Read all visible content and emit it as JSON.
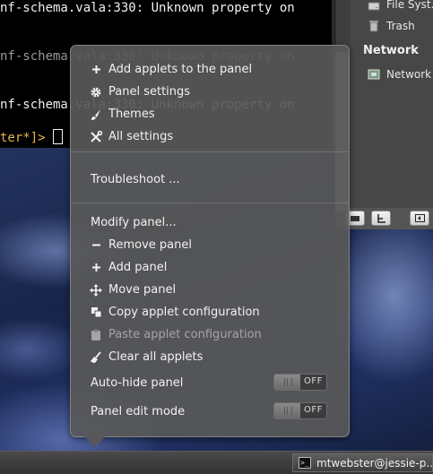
{
  "terminal": {
    "lines": [
      "nf-schema.vala:330: Unknown property on",
      "nf-schema.vala:330: Unknown property on",
      "nf-schema.vala:330: Unknown property on"
    ],
    "prompt": "ter*]>"
  },
  "file_manager": {
    "items": {
      "file_system": "File Syst...",
      "trash": "Trash",
      "network_heading": "Network",
      "network": "Network"
    },
    "toolbar_icons": [
      "drive-icon",
      "tree-view-icon",
      "back-icon"
    ]
  },
  "panel_menu": {
    "items": [
      {
        "label": "Add applets to the panel",
        "icon": "plus-icon"
      },
      {
        "label": "Panel settings",
        "icon": "gear-icon"
      },
      {
        "label": "Themes",
        "icon": "paintbrush-icon"
      },
      {
        "label": "All settings",
        "icon": "tools-icon"
      },
      {
        "label": "Troubleshoot ...",
        "icon": null
      },
      {
        "label": "Modify panel...",
        "icon": null
      },
      {
        "label": "Remove panel",
        "icon": "minus-icon"
      },
      {
        "label": "Add panel",
        "icon": "plus-icon"
      },
      {
        "label": "Move panel",
        "icon": "move-arrows-icon"
      },
      {
        "label": "Copy applet configuration",
        "icon": "copy-icon"
      },
      {
        "label": "Paste applet configuration",
        "icon": "clipboard-icon",
        "disabled": true
      },
      {
        "label": "Clear all applets",
        "icon": "broom-icon"
      }
    ],
    "toggles": [
      {
        "label": "Auto-hide panel",
        "state": "OFF"
      },
      {
        "label": "Panel edit mode",
        "state": "OFF"
      }
    ]
  },
  "taskbar": {
    "window_button": "mtwebster@jessie-p..."
  },
  "colors": {
    "menu_bg": "#585858",
    "text": "#f2f2f2",
    "disabled_text": "#a5a5a5",
    "prompt": "#e6b34a"
  }
}
